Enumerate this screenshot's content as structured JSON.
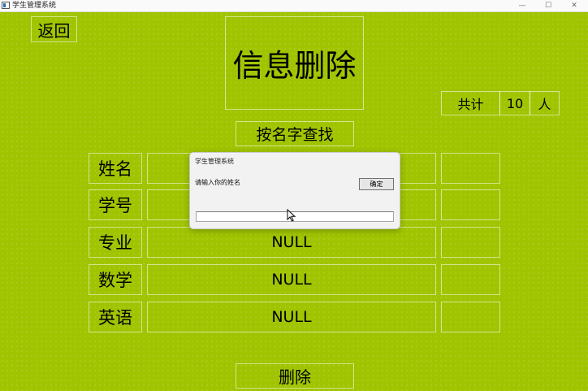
{
  "window": {
    "title": "学生管理系统",
    "minimize_glyph": "—",
    "maximize_glyph": "☐",
    "close_glyph": "✕"
  },
  "back_button": "返回",
  "page_title": "信息删除",
  "total": {
    "label": "共计",
    "count": "10",
    "unit": "人"
  },
  "search_button": "按名字查找",
  "fields": [
    {
      "label": "姓名",
      "value": ""
    },
    {
      "label": "学号",
      "value": ""
    },
    {
      "label": "专业",
      "value": "NULL"
    },
    {
      "label": "数学",
      "value": "NULL"
    },
    {
      "label": "英语",
      "value": "NULL"
    }
  ],
  "delete_button": "删除",
  "dialog": {
    "title": "学生管理系统",
    "prompt": "请输入你的姓名",
    "ok_button": "确定",
    "input_value": ""
  }
}
